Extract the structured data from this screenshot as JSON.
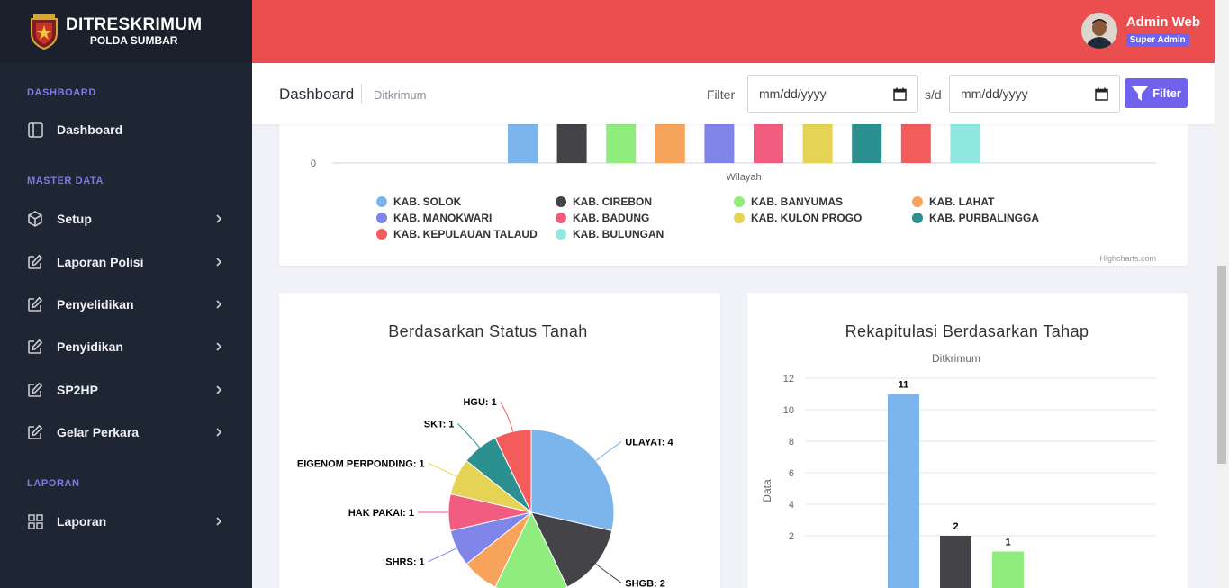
{
  "brand": {
    "name": "DITRESKRIMUM",
    "sub": "POLDA SUMBAR",
    "logo_text": "SUMBAR"
  },
  "sidebar": {
    "sections": [
      {
        "label": "DASHBOARD"
      },
      {
        "label": "MASTER DATA"
      },
      {
        "label": "LAPORAN"
      }
    ],
    "items": [
      {
        "label": "Dashboard",
        "icon": "layout-icon"
      },
      {
        "label": "Setup",
        "icon": "cube-icon"
      },
      {
        "label": "Laporan Polisi",
        "icon": "edit-icon"
      },
      {
        "label": "Penyelidikan",
        "icon": "edit-icon"
      },
      {
        "label": "Penyidikan",
        "icon": "edit-icon"
      },
      {
        "label": "SP2HP",
        "icon": "edit-icon"
      },
      {
        "label": "Gelar Perkara",
        "icon": "edit-icon"
      },
      {
        "label": "Laporan",
        "icon": "grid-icon"
      }
    ]
  },
  "header": {
    "user_name": "Admin Web",
    "user_role": "Super Admin"
  },
  "subbar": {
    "title": "Dashboard",
    "subtitle": "Ditkrimum",
    "filter_label": "Filter",
    "date_from_placeholder": "mm/dd/yyyy",
    "separator": "s/d",
    "date_to_placeholder": "mm/dd/yyyy",
    "filter_button": "Filter"
  },
  "colors": {
    "header": "#eb4e4e",
    "sidebar": "#1e2533",
    "accent": "#6f63ee"
  },
  "chart_data": [
    {
      "type": "bar",
      "xlabel": "Wilayah",
      "y_visible_tick": "0",
      "credit": "Highcharts.com",
      "series": [
        {
          "name": "KAB. SOLOK",
          "color": "#7cb5ec"
        },
        {
          "name": "KAB. CIREBON",
          "color": "#434348"
        },
        {
          "name": "KAB. BANYUMAS",
          "color": "#90ed7d"
        },
        {
          "name": "KAB. LAHAT",
          "color": "#f7a35c"
        },
        {
          "name": "KAB. MANOKWARI",
          "color": "#8085e9"
        },
        {
          "name": "KAB. BADUNG",
          "color": "#f15c80"
        },
        {
          "name": "KAB. KULON PROGO",
          "color": "#e4d354"
        },
        {
          "name": "KAB. PURBALINGGA",
          "color": "#2b908f"
        },
        {
          "name": "KAB. KEPULAUAN TALAUD",
          "color": "#f45b5b"
        },
        {
          "name": "KAB. BULUNGAN",
          "color": "#91e8e1"
        }
      ]
    },
    {
      "type": "pie",
      "title": "Berdasarkan Status Tanah",
      "slices": [
        {
          "label": "ULAYAT",
          "value": 4,
          "color": "#7cb5ec"
        },
        {
          "label": "SHGB",
          "value": 2,
          "color": "#434348"
        },
        {
          "label": "",
          "value": 2,
          "color": "#90ed7d"
        },
        {
          "label": "",
          "value": 1,
          "color": "#f7a35c"
        },
        {
          "label": "SHRS",
          "value": 1,
          "color": "#8085e9"
        },
        {
          "label": "HAK PAKAI",
          "value": 1,
          "color": "#f15c80"
        },
        {
          "label": "EIGENOM PERPONDING",
          "value": 1,
          "color": "#e4d354"
        },
        {
          "label": "SKT",
          "value": 1,
          "color": "#2b908f"
        },
        {
          "label": "HGU",
          "value": 1,
          "color": "#f45b5b"
        }
      ]
    },
    {
      "type": "bar",
      "title": "Rekapitulasi Berdasarkan Tahap",
      "subtitle": "Ditkrimum",
      "ylabel": "Data",
      "yticks": [
        2,
        4,
        6,
        8,
        10,
        12
      ],
      "ylim": [
        0,
        12
      ],
      "values": [
        11,
        2,
        1
      ],
      "colors": [
        "#7cb5ec",
        "#434348",
        "#90ed7d"
      ]
    }
  ]
}
